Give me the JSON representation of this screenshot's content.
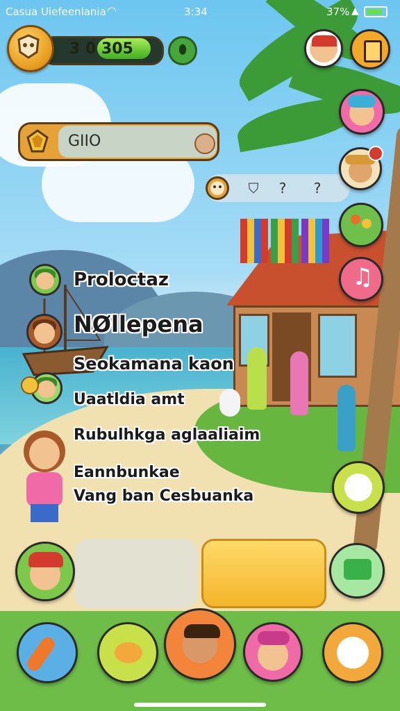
{
  "status_bar": {
    "carrier": "Casua Uiefeenlania",
    "time": "3:34",
    "battery_text": "37%"
  },
  "currency": {
    "value": "3 0 305",
    "fill_fraction": 0.45
  },
  "search": {
    "value": "GIIO"
  },
  "toolbar": {
    "icons": [
      "owl-badge-icon",
      "shield-icon",
      "question-icon",
      "help-icon"
    ],
    "question_glyph": "?",
    "help_glyph": "?"
  },
  "menu": {
    "items": [
      {
        "label": "Proloctaz"
      },
      {
        "label": "NØllepena"
      },
      {
        "label": "Seokamana kaon"
      },
      {
        "label": "Uaatldia amt"
      },
      {
        "label": "Rubulhkga aglaaliaim"
      },
      {
        "label": "Eannbunkae"
      },
      {
        "label": "Vang ban Cesbuanka"
      }
    ]
  },
  "right_buttons": [
    {
      "name": "avatar-boy-red-hat"
    },
    {
      "name": "book-icon"
    },
    {
      "name": "avatar-girl-pink"
    },
    {
      "name": "avatar-boy-hat"
    },
    {
      "name": "flowers-icon"
    },
    {
      "name": "music-icon"
    },
    {
      "name": "cat-icon"
    },
    {
      "name": "chat-icon"
    }
  ],
  "bottom_buttons": [
    {
      "name": "carrot-icon"
    },
    {
      "name": "fish-icon"
    },
    {
      "name": "avatar-boy-center"
    },
    {
      "name": "avatar-girl-pink-hat"
    },
    {
      "name": "pet-icon"
    }
  ],
  "colors": {
    "accent_orange": "#f3b52a",
    "sky": "#6cc6f0",
    "grass": "#66b63f"
  }
}
